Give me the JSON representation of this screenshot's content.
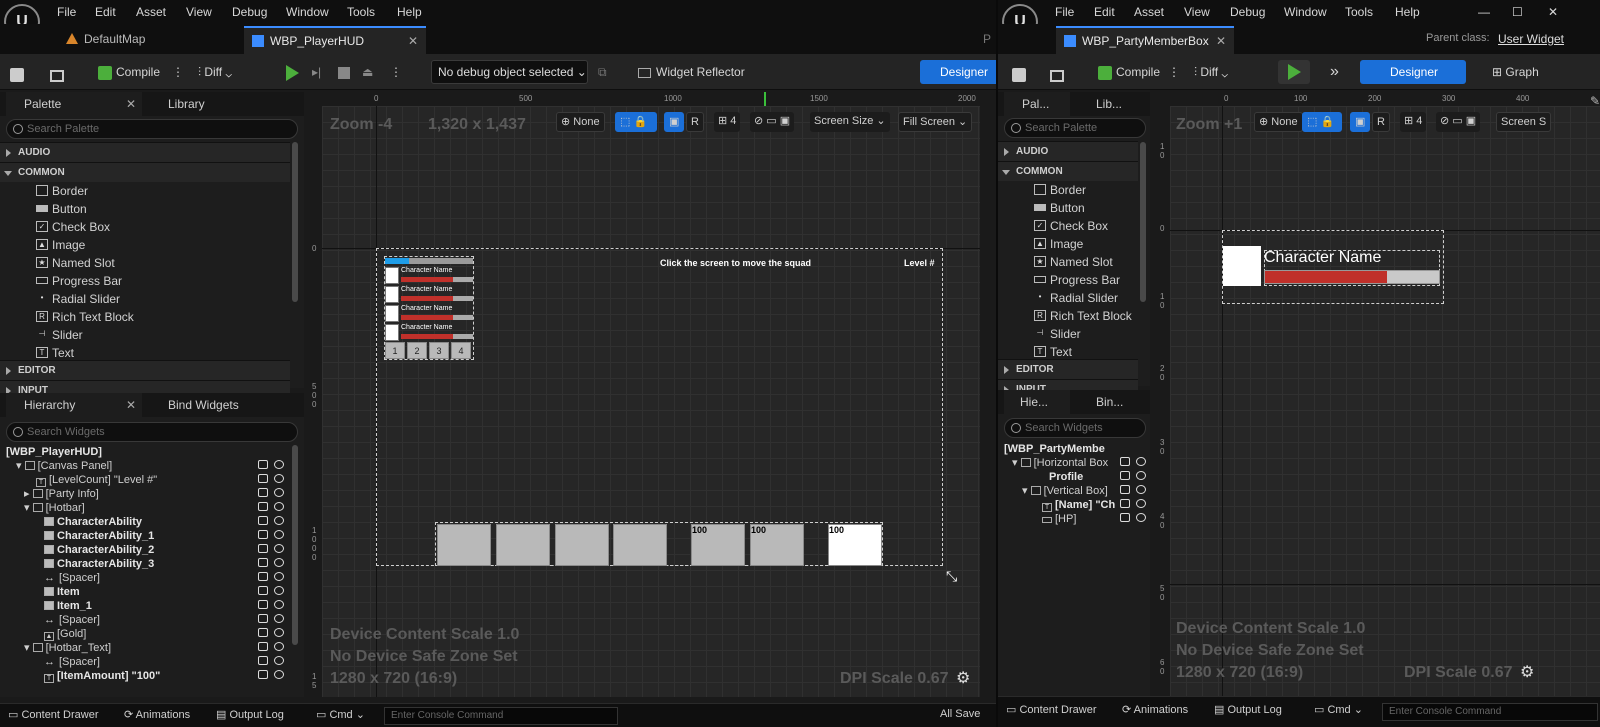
{
  "left": {
    "menu": [
      "File",
      "Edit",
      "Asset",
      "View",
      "Debug",
      "Window",
      "Tools",
      "Help"
    ],
    "tabs": {
      "map": "DefaultMap",
      "hud": "WBP_PlayerHUD",
      "trailing": "P"
    },
    "toolbar": {
      "compile": "Compile",
      "diff": "Diff",
      "debug": "No debug object selected",
      "reflector": "Widget Reflector",
      "designer": "Designer"
    },
    "palette": {
      "tab": "Palette",
      "library": "Library",
      "search": "Search Palette",
      "cats": {
        "audio": "AUDIO",
        "common": "COMMON",
        "editor": "EDITOR",
        "input": "INPUT"
      },
      "items": [
        "Border",
        "Button",
        "Check Box",
        "Image",
        "Named Slot",
        "Progress Bar",
        "Radial Slider",
        "Rich Text Block",
        "Slider",
        "Text"
      ]
    },
    "hierarchy": {
      "tab": "Hierarchy",
      "bind": "Bind Widgets",
      "search": "Search Widgets",
      "items": [
        "[WBP_PlayerHUD]",
        "[Canvas Panel]",
        "[LevelCount] \"Level #\"",
        "[Party Info]",
        "[Hotbar]",
        "CharacterAbility",
        "CharacterAbility_1",
        "CharacterAbility_2",
        "CharacterAbility_3",
        "[Spacer]",
        "Item",
        "Item_1",
        "[Spacer]",
        "[Gold]",
        "[Hotbar_Text]",
        "[Spacer]",
        "[ItemAmount] \"100\""
      ]
    },
    "viewport": {
      "zoom": "Zoom -4",
      "res": "1,320 x 1,437",
      "none": "None",
      "r": "R",
      "grid": "4",
      "screen": "Screen Size",
      "fill": "Fill Screen",
      "rulerH": [
        "0",
        "500",
        "1000",
        "1500",
        "2000"
      ],
      "rulerV": {
        "top": "0",
        "mid": "5 0 0",
        "bot": "1 0 0 0",
        "end": "1 5"
      },
      "click": "Click the screen to move the squad",
      "level": "Level #",
      "charname": "Character Name",
      "slots": [
        "1",
        "2",
        "3",
        "4"
      ],
      "amounts": [
        "100",
        "100",
        "100"
      ],
      "dcs": "Device Content Scale 1.0",
      "safe": "No Device Safe Zone Set",
      "size": "1280 x 720 (16:9)",
      "dpi": "DPI Scale 0.67"
    },
    "bottom": {
      "drawer": "Content Drawer",
      "anim": "Animations",
      "log": "Output Log",
      "cmd": "Cmd",
      "console": "Enter Console Command"
    }
  },
  "right": {
    "menu": [
      "File",
      "Edit",
      "Asset",
      "View",
      "Debug",
      "Window",
      "Tools",
      "Help"
    ],
    "tab": "WBP_PartyMemberBox",
    "parentLabel": "Parent class:",
    "parentValue": "User Widget",
    "toolbar": {
      "compile": "Compile",
      "diff": "Diff",
      "designer": "Designer",
      "graph": "Graph"
    },
    "palette": {
      "tab": "Pal...",
      "library": "Lib...",
      "search": "Search Palette",
      "cats": {
        "audio": "AUDIO",
        "common": "COMMON",
        "editor": "EDITOR",
        "input": "INPUT"
      },
      "items": [
        "Border",
        "Button",
        "Check Box",
        "Image",
        "Named Slot",
        "Progress Bar",
        "Radial Slider",
        "Rich Text Block",
        "Slider",
        "Text"
      ]
    },
    "hierarchy": {
      "tab": "Hie...",
      "bind": "Bin...",
      "search": "Search Widgets",
      "items": [
        "[WBP_PartyMembe",
        "[Horizontal Box",
        "Profile",
        "[Vertical Box]",
        "[Name] \"Ch",
        "[HP]"
      ]
    },
    "viewport": {
      "zoom": "Zoom +1",
      "none": "None",
      "r": "R",
      "grid": "4",
      "screen": "Screen S",
      "rulerH": [
        "0",
        "100",
        "200",
        "300",
        "400"
      ],
      "rulerV": {
        "a": "1 0",
        "b": "0",
        "c": "1 0",
        "d": "2 0",
        "e": "3 0",
        "f": "4 0",
        "g": "5 0",
        "h": "6 0"
      },
      "charname": "Character Name",
      "hp": 0.7,
      "dcs": "Device Content Scale 1.0",
      "safe": "No Device Safe Zone Set",
      "size": "1280 x 720 (16:9)",
      "dpi": "DPI Scale 0.67"
    },
    "bottom": {
      "drawer": "Content Drawer",
      "anim": "Animations",
      "log": "Output Log",
      "cmd": "Cmd",
      "console": "Enter Console Command"
    }
  },
  "overlap": {
    "allSave": "All Save"
  },
  "colors": {
    "accent": "#1b6fd8",
    "play": "#4caf3c",
    "hpRed": "#c0302a"
  }
}
